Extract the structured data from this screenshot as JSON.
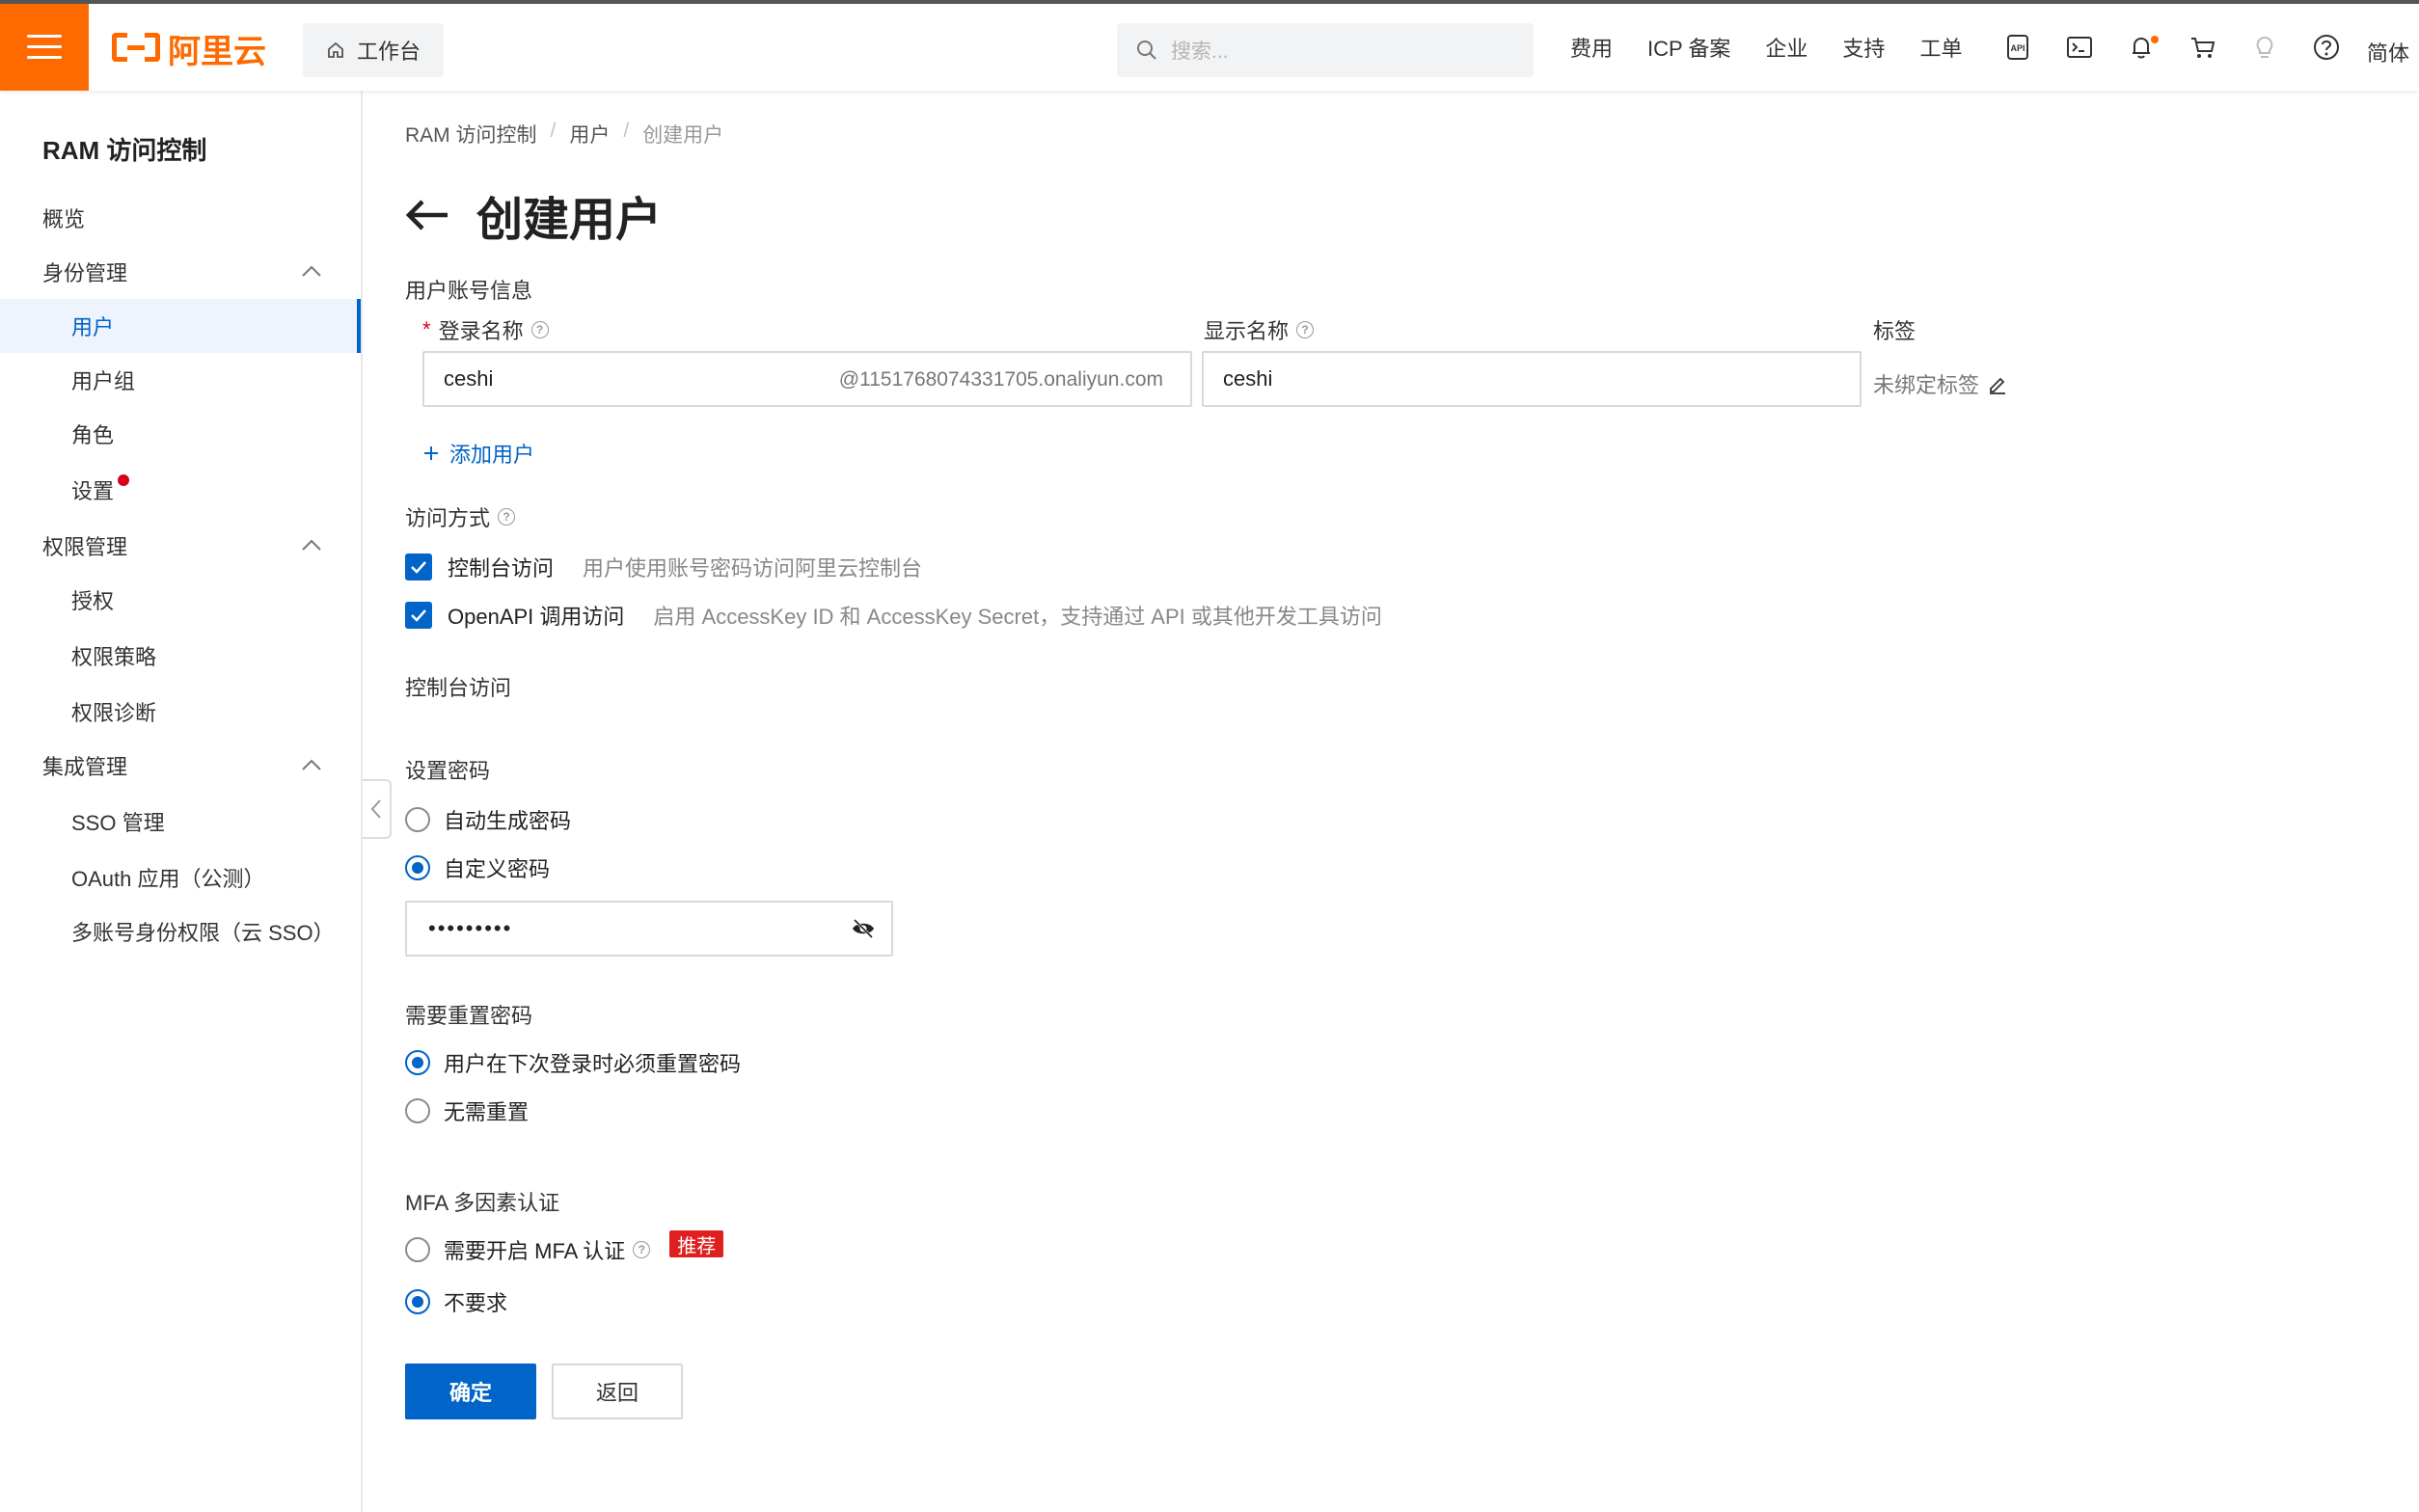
{
  "topbar": {
    "logo_text": "阿里云",
    "workbench_label": "工作台",
    "search_placeholder": "搜索...",
    "nav": [
      "费用",
      "ICP 备案",
      "企业",
      "支持",
      "工单"
    ],
    "lang": "简体",
    "accent_color": "#ff6a00"
  },
  "sidebar": {
    "title": "RAM 访问控制",
    "items": [
      {
        "label": "概览"
      },
      {
        "label": "身份管理"
      },
      {
        "label": "用户"
      },
      {
        "label": "用户组"
      },
      {
        "label": "角色"
      },
      {
        "label": "设置"
      },
      {
        "label": "权限管理"
      },
      {
        "label": "授权"
      },
      {
        "label": "权限策略"
      },
      {
        "label": "权限诊断"
      },
      {
        "label": "集成管理"
      },
      {
        "label": "SSO 管理"
      },
      {
        "label": "OAuth 应用（公测）"
      },
      {
        "label": "多账号身份权限（云 SSO）"
      }
    ]
  },
  "breadcrumb": [
    "RAM 访问控制",
    "用户",
    "创建用户"
  ],
  "page_title": "创建用户",
  "account_info": {
    "section_title": "用户账号信息",
    "login_name_label": "登录名称",
    "login_name_value": "ceshi",
    "login_name_suffix": "@1151768074331705.onaliyun.com",
    "display_name_label": "显示名称",
    "display_name_value": "ceshi",
    "tags_label": "标签",
    "tags_value": "未绑定标签",
    "add_user": "添加用户"
  },
  "access": {
    "section_title": "访问方式",
    "console_label": "控制台访问",
    "console_desc": "用户使用账号密码访问阿里云控制台",
    "api_label": "OpenAPI 调用访问",
    "api_desc": "启用 AccessKey ID 和 AccessKey Secret，支持通过 API 或其他开发工具访问"
  },
  "console_section": {
    "title": "控制台访问",
    "password_title": "设置密码",
    "auto_password": "自动生成密码",
    "custom_password": "自定义密码",
    "password_value": "•••••••••",
    "reset_title": "需要重置密码",
    "reset_required": "用户在下次登录时必须重置密码",
    "reset_none": "无需重置",
    "mfa_title": "MFA 多因素认证",
    "mfa_required": "需要开启 MFA 认证",
    "mfa_badge": "推荐",
    "mfa_none": "不要求"
  },
  "actions": {
    "confirm": "确定",
    "back": "返回"
  },
  "colors": {
    "primary": "#0064c8",
    "danger": "#e02020"
  }
}
